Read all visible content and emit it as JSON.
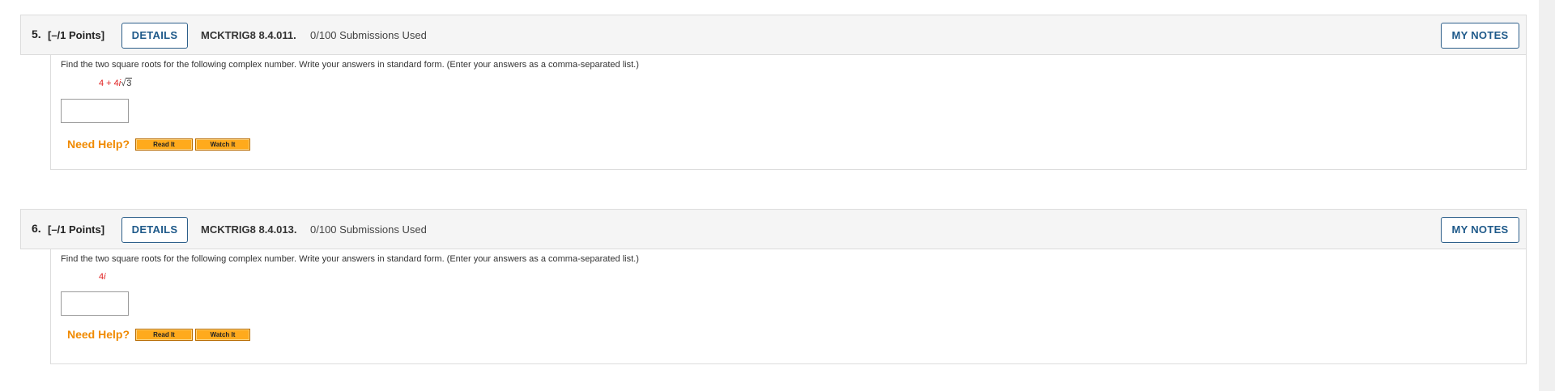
{
  "questions": [
    {
      "number": "5.",
      "points": "[–/1 Points]",
      "details_label": "DETAILS",
      "code": "MCKTRIG8 8.4.011.",
      "submissions": "0/100 Submissions Used",
      "notes_label": "MY NOTES",
      "prompt": "Find the two square roots for the following complex number. Write your answers in standard form. (Enter your answers as a comma-separated list.)",
      "expression": {
        "lead": "4 + 4",
        "imag": "i",
        "radical_sign": "√",
        "radicand": "3"
      },
      "answer_value": "",
      "need_help_label": "Need Help?",
      "read_label": "Read It",
      "watch_label": "Watch It"
    },
    {
      "number": "6.",
      "points": "[–/1 Points]",
      "details_label": "DETAILS",
      "code": "MCKTRIG8 8.4.013.",
      "submissions": "0/100 Submissions Used",
      "notes_label": "MY NOTES",
      "prompt": "Find the two square roots for the following complex number. Write your answers in standard form. (Enter your answers as a comma-separated list.)",
      "expression": {
        "lead": "4",
        "imag": "i"
      },
      "answer_value": "",
      "need_help_label": "Need Help?",
      "read_label": "Read It",
      "watch_label": "Watch It"
    }
  ],
  "colors": {
    "accent_blue": "#1f5a8a",
    "help_orange": "#f08a00",
    "math_red": "#e02020",
    "help_button": "#ffaa1c"
  }
}
